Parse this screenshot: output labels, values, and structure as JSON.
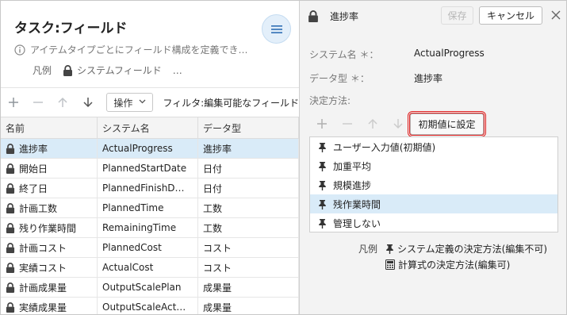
{
  "left": {
    "title": "タスク:フィールド",
    "info_text": "アイテムタイプごとにフィールド構成を定義でき…",
    "legend_label": "凡例",
    "legend_item": "システムフィールド",
    "legend_more": "…",
    "toolbar": {
      "operation_label": "操作",
      "filter_label": "フィルタ:編集可能なフィールド"
    },
    "columns": [
      "名前",
      "システム名",
      "データ型"
    ],
    "rows": [
      {
        "name": "進捗率",
        "system_name": "ActualProgress",
        "type": "進捗率"
      },
      {
        "name": "開始日",
        "system_name": "PlannedStartDate",
        "type": "日付"
      },
      {
        "name": "終了日",
        "system_name": "PlannedFinishD…",
        "type": "日付"
      },
      {
        "name": "計画工数",
        "system_name": "PlannedTime",
        "type": "工数"
      },
      {
        "name": "残り作業時間",
        "system_name": "RemainingTime",
        "type": "工数"
      },
      {
        "name": "計画コスト",
        "system_name": "PlannedCost",
        "type": "コスト"
      },
      {
        "name": "実績コスト",
        "system_name": "ActualCost",
        "type": "コスト"
      },
      {
        "name": "計画成果量",
        "system_name": "OutputScalePlan",
        "type": "成果量"
      },
      {
        "name": "実績成果量",
        "system_name": "OutputScaleAct…",
        "type": "成果量"
      }
    ]
  },
  "right": {
    "title": "進捗率",
    "save_label": "保存",
    "cancel_label": "キャンセル",
    "system_name_label": "システム名 ＊：",
    "system_name_value": "ActualProgress",
    "data_type_label": "データ型 ＊：",
    "data_type_value": "進捗率",
    "method_label": "決定方法:",
    "init_button": "初期値に設定",
    "methods": [
      "ユーザー入力値(初期値)",
      "加重平均",
      "規模進捗",
      "残作業時間",
      "管理しない"
    ],
    "legend_label": "凡例",
    "legend_system": "システム定義の決定方法(編集不可)",
    "legend_formula": "計算式の決定方法(編集可)"
  },
  "colors": {
    "accent": "#2f6fb5",
    "selected_row": "#d9ebf8",
    "highlight": "#e02020"
  }
}
